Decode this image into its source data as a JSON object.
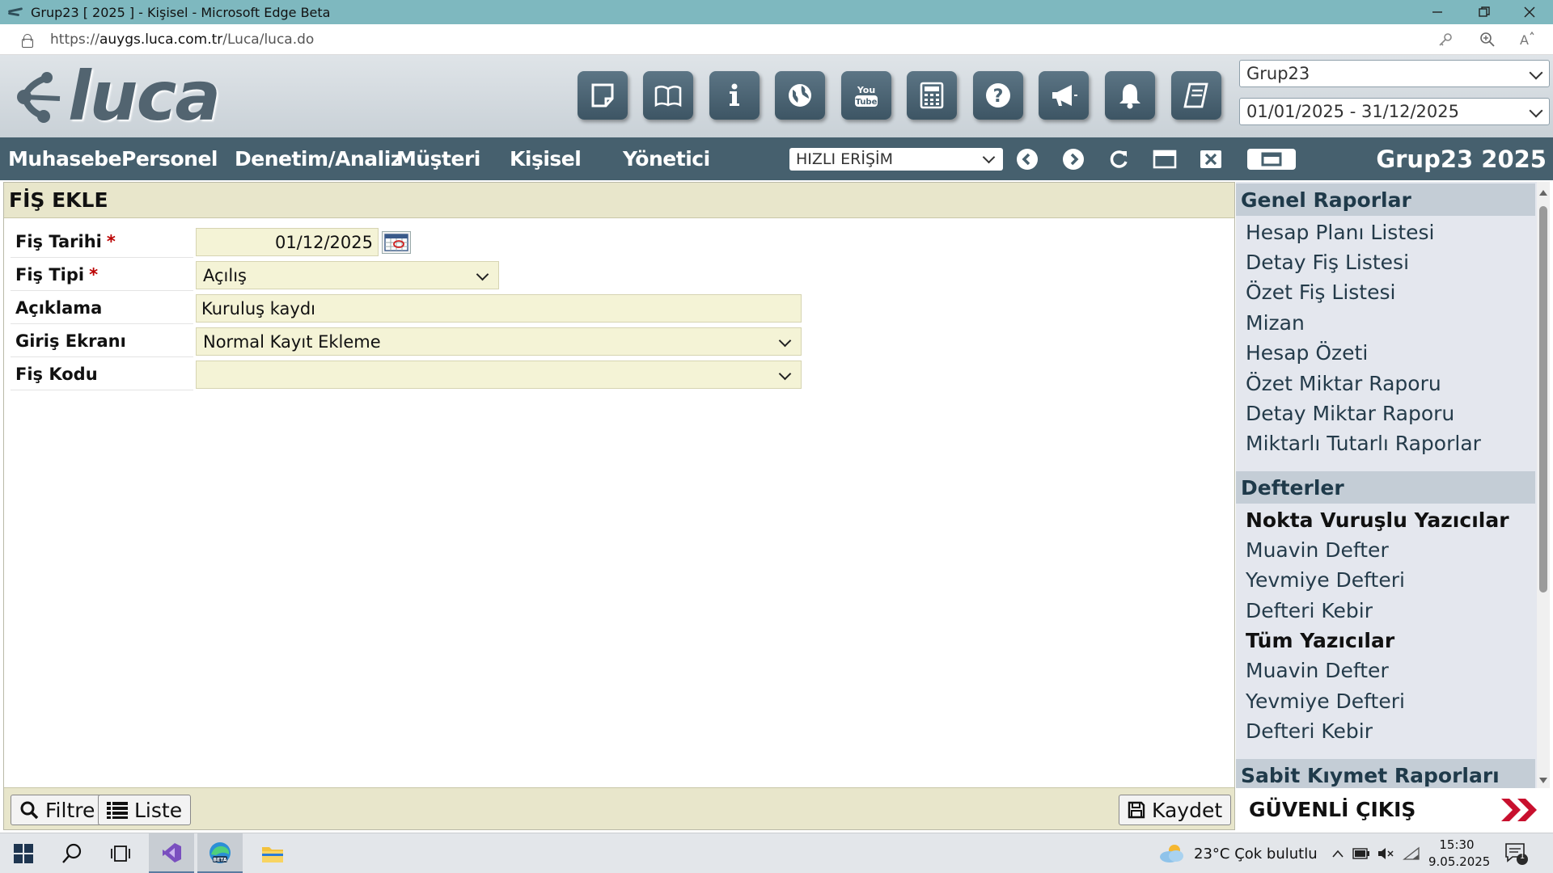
{
  "browser": {
    "window_title": "Grup23 [ 2025 ] - Kişisel - Microsoft Edge Beta",
    "url_prefix": "https://",
    "url_host": "auygs.luca.com.tr",
    "url_path": "/Luca/luca.do"
  },
  "app": {
    "logo_text": "luca",
    "toolbar_icons": [
      "notes-icon",
      "manual-book-icon",
      "info-icon",
      "globe-icon",
      "youtube-icon",
      "calculator-icon",
      "help-icon",
      "announcement-icon",
      "notification-bell-icon",
      "notebook-icon"
    ],
    "company_select": "Grup23",
    "period_select": "01/01/2025 - 31/12/2025",
    "brand_title": "Grup23 2025",
    "accent_color": "#46606e"
  },
  "nav": {
    "items": [
      "Muhasebe",
      "Personel",
      "Denetim/Analiz",
      "Müşteri",
      "Kişisel",
      "Yönetici"
    ],
    "quick_access": "HIZLI ERİŞİM"
  },
  "form": {
    "title": "FİŞ EKLE",
    "fields": [
      {
        "label": "Fiş Tarihi",
        "required": "*",
        "value": "01/12/2025"
      },
      {
        "label": "Fiş Tipi",
        "required": "*",
        "value": "Açılış"
      },
      {
        "label": "Açıklama",
        "required": "",
        "value": "Kuruluş kaydı"
      },
      {
        "label": "Giriş Ekranı",
        "required": "",
        "value": "Normal Kayıt Ekleme"
      },
      {
        "label": "Fiş Kodu",
        "required": "",
        "value": ""
      }
    ],
    "buttons": {
      "filter": "Filtre",
      "list": "Liste",
      "save": "Kaydet"
    }
  },
  "reports": {
    "sections": [
      {
        "title": "Genel Raporlar",
        "items": [
          "Hesap Planı Listesi",
          "Detay Fiş Listesi",
          "Özet Fiş Listesi",
          "Mizan",
          "Hesap Özeti",
          "Özet Miktar Raporu",
          "Detay Miktar Raporu",
          "Miktarlı Tutarlı Raporlar"
        ]
      },
      {
        "title": "Defterler",
        "subsections": [
          {
            "title": "Nokta Vuruşlu Yazıcılar",
            "items": [
              "Muavin Defter",
              "Yevmiye Defteri",
              "Defteri Kebir"
            ]
          },
          {
            "title": "Tüm Yazıcılar",
            "items": [
              "Muavin Defter",
              "Yevmiye Defteri",
              "Defteri Kebir"
            ]
          }
        ]
      },
      {
        "title": "Sabit Kıymet Raporları",
        "items": []
      }
    ],
    "logout": "GÜVENLİ ÇIKIŞ"
  },
  "taskbar": {
    "weather": "23°C  Çok bulutlu",
    "time": "15:30",
    "date": "9.05.2025",
    "notification_count": "1"
  }
}
